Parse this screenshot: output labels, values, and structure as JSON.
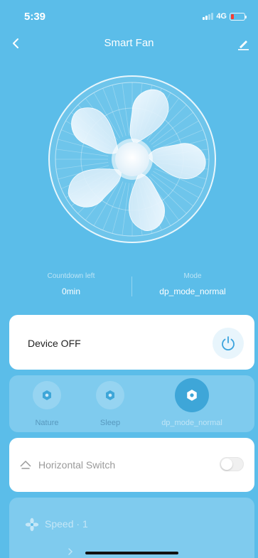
{
  "status_bar": {
    "time": "5:39",
    "network": "4G",
    "battery_level": 0.15,
    "battery_color": "#ff3b30"
  },
  "nav": {
    "title": "Smart Fan",
    "back_icon": "chevron-left-icon",
    "edit_icon": "pencil-icon"
  },
  "info": {
    "countdown_label": "Countdown left",
    "countdown_value": "0min",
    "mode_label": "Mode",
    "mode_value": "dp_mode_normal"
  },
  "power": {
    "label": "Device OFF",
    "icon": "power-icon",
    "accent": "#3aa3dd"
  },
  "modes": [
    {
      "label": "Nature",
      "icon": "mode-hex-icon",
      "active": false
    },
    {
      "label": "Sleep",
      "icon": "mode-hex-icon",
      "active": false
    },
    {
      "label": "dp_mode_normal",
      "icon": "mode-hex-icon",
      "active": true
    }
  ],
  "horizontal_switch": {
    "label": "Horizontal Switch",
    "icon": "swing-icon",
    "on": false
  },
  "speed": {
    "label": "Speed",
    "separator": "·",
    "value": "1",
    "icon": "fan-icon"
  },
  "colors": {
    "background": "#5bbde9",
    "card": "#ffffff",
    "active_mode": "#3ea6d8"
  }
}
